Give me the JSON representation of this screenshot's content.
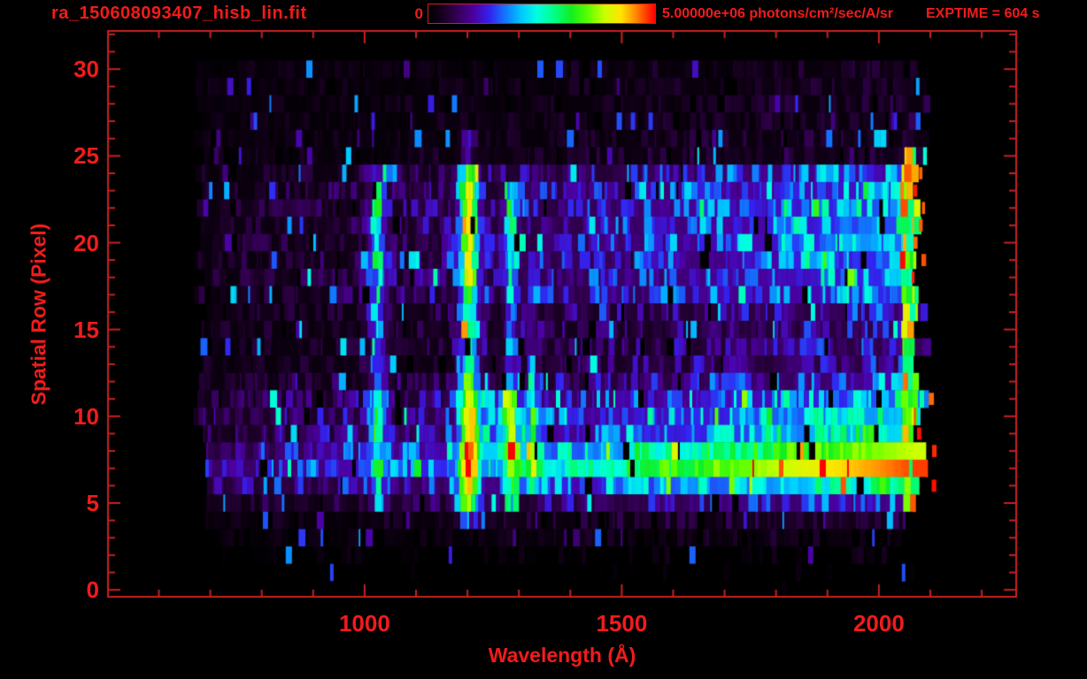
{
  "header": {
    "filename": "ra_150608093407_hisb_lin.fit",
    "exptime_label": "EXPTIME = 604 s",
    "colorbar": {
      "min_label": "0",
      "max_label": "5.00000e+06",
      "units": "photons/cm²/sec/A/sr"
    }
  },
  "chart_data": {
    "type": "heatmap",
    "title": "ra_150608093407_hisb_lin.fit",
    "xlabel": "Wavelength (Å)",
    "ylabel": "Spatial Row (Pixel)",
    "xlim": [
      501,
      2267
    ],
    "ylim": [
      -0.4,
      32.2
    ],
    "x_major_ticks": [
      1000,
      1500,
      2000
    ],
    "x_minor_step": 100,
    "x_minor_range": [
      600,
      2200
    ],
    "y_major_ticks": [
      0,
      5,
      10,
      15,
      20,
      25,
      30
    ],
    "y_minor_step": 1,
    "y_minor_range": [
      0,
      32
    ],
    "grid": false,
    "legend": "none",
    "colorbar": {
      "min": 0,
      "max": 5000000,
      "units": "photons/cm²/sec/A/sr",
      "position": "top"
    },
    "exptime_seconds": 604,
    "axis_color": "#c92020",
    "text_color": "#f21b1b",
    "background_color": "#000000",
    "colormap": {
      "name": "rainbow",
      "stops": [
        [
          0.0,
          "#000000"
        ],
        [
          0.06,
          "#16001e"
        ],
        [
          0.12,
          "#31004e"
        ],
        [
          0.2,
          "#4b00a0"
        ],
        [
          0.27,
          "#3322ee"
        ],
        [
          0.34,
          "#1177ff"
        ],
        [
          0.41,
          "#00c8ff"
        ],
        [
          0.48,
          "#00ffe0"
        ],
        [
          0.56,
          "#00ff80"
        ],
        [
          0.63,
          "#11ee22"
        ],
        [
          0.7,
          "#55ff00"
        ],
        [
          0.78,
          "#ccff00"
        ],
        [
          0.85,
          "#ffe400"
        ],
        [
          0.91,
          "#ff9100"
        ],
        [
          0.96,
          "#ff3c00"
        ],
        [
          1.0,
          "#ff0000"
        ]
      ]
    },
    "heatmap_model": {
      "seed": 150608,
      "lambda_min": 660,
      "lambda_max": 2070,
      "continuum_gamma": 1.4,
      "row_extent": {
        "start_lambda": 666,
        "start_jitter": 28,
        "end_lambda": 2055,
        "end_jitter": 40
      },
      "row_density": [
        0.03,
        0.1,
        0.3,
        0.75,
        0.92,
        0.97,
        0.97,
        0.97,
        0.97,
        0.97,
        0.97,
        0.97,
        0.97,
        0.97,
        0.97,
        0.97,
        0.97,
        0.97,
        0.97,
        0.97,
        0.97,
        0.97,
        0.97,
        0.97,
        0.97,
        0.95,
        0.95,
        0.95,
        0.95,
        0.95,
        0.95
      ],
      "row_continuum": [
        [
          0.005,
          0.02
        ],
        [
          0.01,
          0.03
        ],
        [
          0.02,
          0.04
        ],
        [
          0.03,
          0.06
        ],
        [
          0.04,
          0.1
        ],
        [
          0.08,
          0.3
        ],
        [
          0.14,
          0.6
        ],
        [
          0.22,
          0.96
        ],
        [
          0.18,
          0.78
        ],
        [
          0.12,
          0.55
        ],
        [
          0.12,
          0.52
        ],
        [
          0.1,
          0.44
        ],
        [
          0.07,
          0.3
        ],
        [
          0.05,
          0.22
        ],
        [
          0.05,
          0.22
        ],
        [
          0.05,
          0.22
        ],
        [
          0.05,
          0.24
        ],
        [
          0.06,
          0.4
        ],
        [
          0.06,
          0.42
        ],
        [
          0.06,
          0.42
        ],
        [
          0.06,
          0.44
        ],
        [
          0.06,
          0.44
        ],
        [
          0.06,
          0.42
        ],
        [
          0.06,
          0.4
        ],
        [
          0.05,
          0.34
        ],
        [
          0.035,
          0.1
        ],
        [
          0.03,
          0.08
        ],
        [
          0.03,
          0.07
        ],
        [
          0.03,
          0.07
        ],
        [
          0.03,
          0.06
        ],
        [
          0.03,
          0.06
        ]
      ],
      "emission_lines": [
        {
          "wavelength": 1026,
          "sigma": 11,
          "amp_rows": [
            [
              5,
              8,
              0.28
            ],
            [
              9,
              11,
              0.43
            ],
            [
              12,
              18,
              0.3
            ],
            [
              19,
              23,
              0.38
            ],
            [
              24,
              24,
              0.22
            ]
          ]
        },
        {
          "wavelength": 1203,
          "sigma": 13,
          "amp_rows": [
            [
              4,
              4,
              0.25
            ],
            [
              5,
              9,
              0.62
            ],
            [
              10,
              12,
              0.63
            ],
            [
              13,
              17,
              0.53
            ],
            [
              18,
              23,
              0.69
            ],
            [
              24,
              24,
              0.58
            ],
            [
              25,
              26,
              0.12
            ]
          ]
        },
        {
          "wavelength": 1285,
          "sigma": 9,
          "amp_rows": [
            [
              5,
              7,
              0.3
            ],
            [
              8,
              11,
              0.43
            ],
            [
              12,
              16,
              0.27
            ],
            [
              17,
              23,
              0.34
            ]
          ]
        },
        {
          "wavelength": 1327,
          "sigma": 8,
          "amp_rows": [
            [
              6,
              12,
              0.34
            ],
            [
              13,
              19,
              0.17
            ]
          ]
        }
      ],
      "bridge": {
        "rows": [
          8,
          11
        ],
        "wavelength": [
          1210,
          1310
        ],
        "boost": 0.1
      },
      "edge_strip": {
        "wavelength": [
          2045,
          2075
        ],
        "rows": [
          5,
          25
        ],
        "min_frac": 0.5,
        "max_frac": 1.0
      },
      "spike_chance": 0.05,
      "spike_boost": [
        0.12,
        0.25
      ]
    }
  }
}
